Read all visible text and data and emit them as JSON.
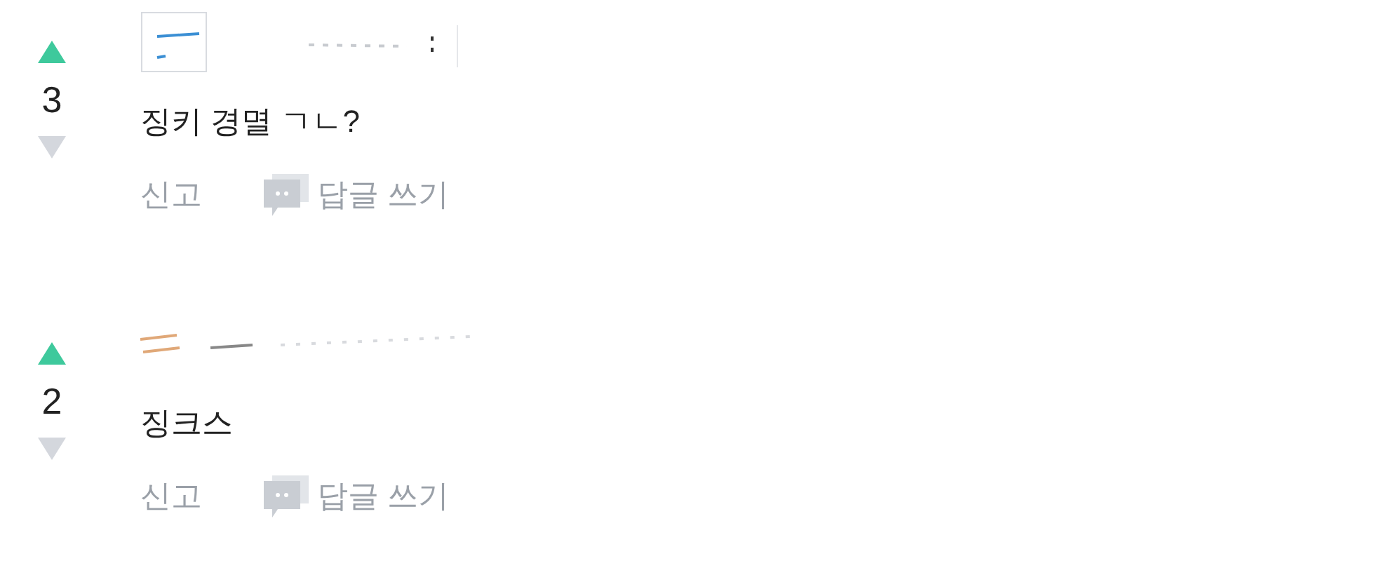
{
  "comments": [
    {
      "score": "3",
      "text": "징키 경멸 ㄱㄴ?",
      "actions": {
        "report": "신고",
        "reply": "답글 쓰기"
      }
    },
    {
      "score": "2",
      "text": "징크스",
      "actions": {
        "report": "신고",
        "reply": "답글 쓰기"
      }
    }
  ]
}
